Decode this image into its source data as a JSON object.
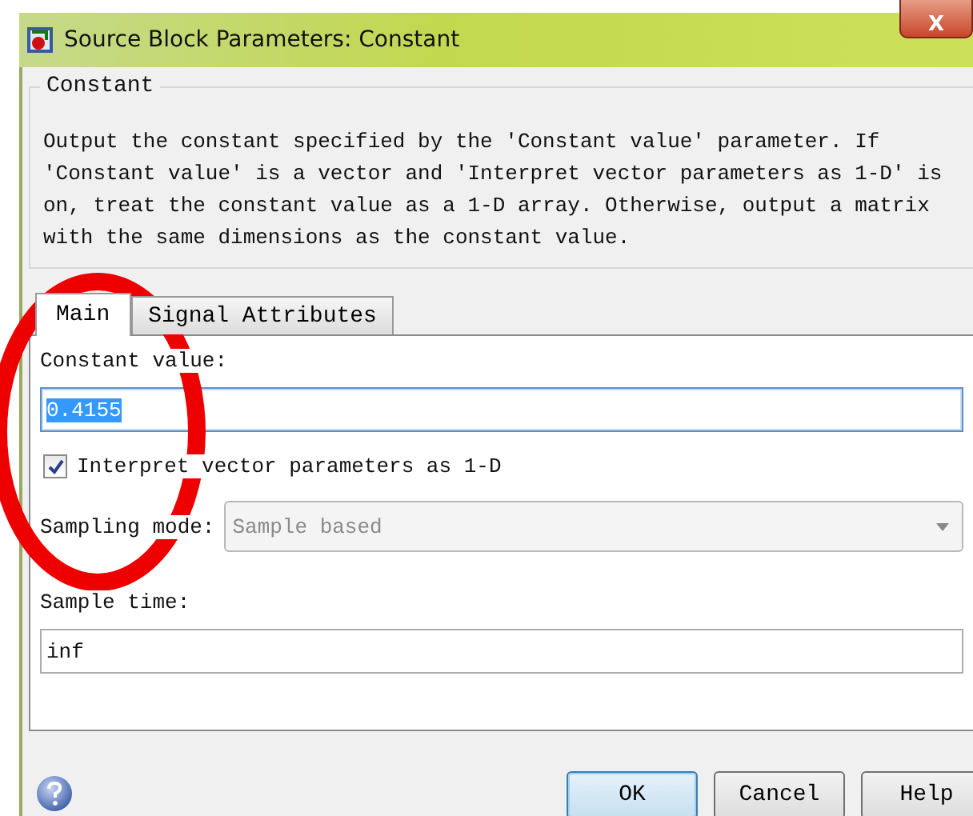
{
  "window": {
    "title": "Source Block Parameters: Constant",
    "close_label": "X"
  },
  "group": {
    "title": "Constant",
    "description": "Output the constant specified by the 'Constant value' parameter. If 'Constant value' is a vector and 'Interpret vector parameters as 1-D' is on, treat the constant value as a 1-D array. Otherwise, output a matrix with the same dimensions as the constant value."
  },
  "tabs": [
    {
      "label": "Main",
      "selected": true
    },
    {
      "label": "Signal Attributes",
      "selected": false
    }
  ],
  "constant_value": {
    "label": "Constant value:",
    "value": "0.4155",
    "text_selected": true
  },
  "interpret_checkbox": {
    "label": "Interpret vector parameters as 1-D",
    "checked": true
  },
  "sampling_mode": {
    "label": "Sampling mode:",
    "value": "Sample based",
    "disabled": true
  },
  "sample_time": {
    "label": "Sample time:",
    "value": "inf"
  },
  "buttons": [
    {
      "label": "OK",
      "default": true
    },
    {
      "label": "Cancel",
      "default": false
    },
    {
      "label": "Help",
      "default": false
    }
  ],
  "annotation": {
    "kind": "ellipse",
    "color": "#ee0000"
  }
}
